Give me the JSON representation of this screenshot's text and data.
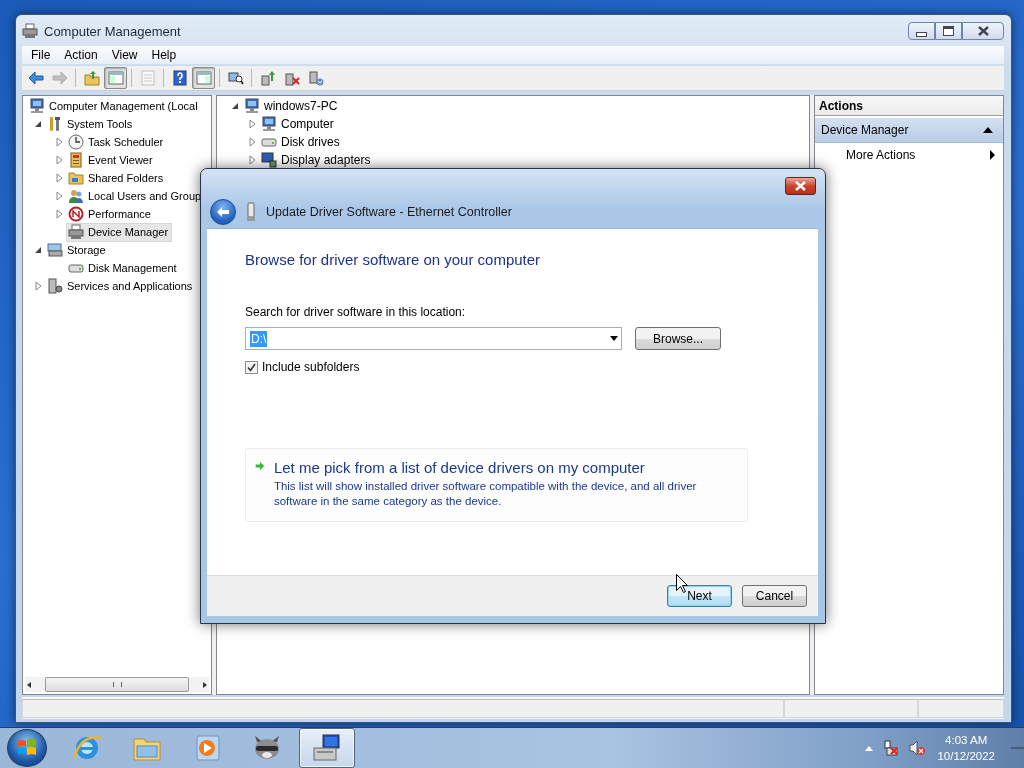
{
  "main_window": {
    "title": "Computer Management",
    "menu": [
      "File",
      "Action",
      "View",
      "Help"
    ],
    "toolbar": [
      {
        "pressed": false,
        "disabled": false
      },
      {
        "pressed": false,
        "disabled": true
      },
      {
        "pressed": false,
        "disabled": false
      },
      {
        "pressed": true,
        "disabled": false
      },
      {
        "pressed": false,
        "disabled": true
      },
      {
        "pressed": false,
        "disabled": false
      },
      {
        "pressed": true,
        "disabled": false
      },
      {
        "pressed": false,
        "disabled": false
      },
      {
        "pressed": false,
        "disabled": false
      },
      {
        "pressed": false,
        "disabled": false
      },
      {
        "pressed": false,
        "disabled": false
      }
    ],
    "console_tree": [
      {
        "kind": "top",
        "label": "Computer Management (Local",
        "selected": false,
        "children": [
          {
            "kind": "node",
            "label": "System Tools",
            "expanded": true,
            "selected": false,
            "children": [
              {
                "kind": "node",
                "label": "Task Scheduler",
                "expanded": false,
                "selected": false
              },
              {
                "kind": "node",
                "label": "Event Viewer",
                "expanded": false,
                "selected": false
              },
              {
                "kind": "node",
                "label": "Shared Folders",
                "expanded": false,
                "selected": false
              },
              {
                "kind": "node",
                "label": "Local Users and Group",
                "expanded": false,
                "selected": false
              },
              {
                "kind": "node",
                "label": "Performance",
                "expanded": false,
                "selected": false
              },
              {
                "kind": "leaf",
                "label": "Device Manager",
                "selected": true
              }
            ]
          },
          {
            "kind": "node",
            "label": "Storage",
            "expanded": true,
            "selected": false,
            "children": [
              {
                "kind": "leaf",
                "label": "Disk Management",
                "selected": false
              }
            ]
          },
          {
            "kind": "node",
            "label": "Services and Applications",
            "expanded": false,
            "selected": false
          }
        ]
      }
    ],
    "device_tree": [
      {
        "kind": "node",
        "label": "windows7-PC",
        "expanded": true,
        "children": [
          {
            "kind": "node",
            "label": "Computer",
            "expanded": false
          },
          {
            "kind": "node",
            "label": "Disk drives",
            "expanded": false
          },
          {
            "kind": "node",
            "label": "Display adapters",
            "expanded": false
          }
        ]
      }
    ],
    "actions": {
      "header": "Actions",
      "sections": [
        {
          "label": "Device Manager",
          "expanded": true,
          "items": [
            {
              "label": "More Actions"
            }
          ]
        }
      ]
    }
  },
  "dialog": {
    "title": "Update Driver Software - Ethernet Controller",
    "heading": "Browse for driver software on your computer",
    "location_label": "Search for driver software in this location:",
    "location": {
      "value": "D:\\",
      "text_selected": true
    },
    "browse_button": "Browse...",
    "include_subfolders": {
      "label": "Include subfolders",
      "checked": true
    },
    "option": {
      "title": "Let me pick from a list of device drivers on my computer",
      "description": "This list will show installed driver software compatible with the device, and all driver software in the same category as the device."
    },
    "buttons": [
      {
        "label": "Next",
        "default": true
      },
      {
        "label": "Cancel",
        "default": false
      }
    ]
  },
  "taskbar": {
    "apps": [
      {
        "selected": false
      },
      {
        "selected": false
      },
      {
        "selected": false
      },
      {
        "selected": false
      },
      {
        "selected": true
      }
    ],
    "clock": {
      "time": "4:03 AM",
      "date": "10/12/2022"
    }
  }
}
